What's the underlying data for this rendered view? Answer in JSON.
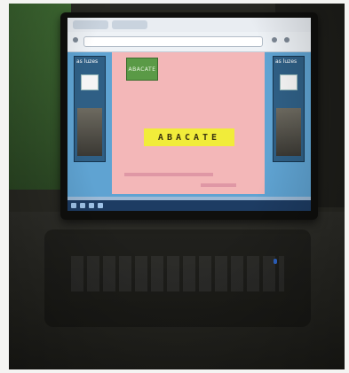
{
  "slide": {
    "word_button": "ABACATE",
    "word_banner": "ABACATE"
  },
  "side_left": {
    "label": "as luzes"
  },
  "side_right": {
    "label": "as luzes"
  },
  "colors": {
    "slide_bg": "#f3b7b8",
    "banner": "#f1ec3a",
    "word_button": "#5a9a46",
    "page_bg": "#5fa3d2"
  }
}
